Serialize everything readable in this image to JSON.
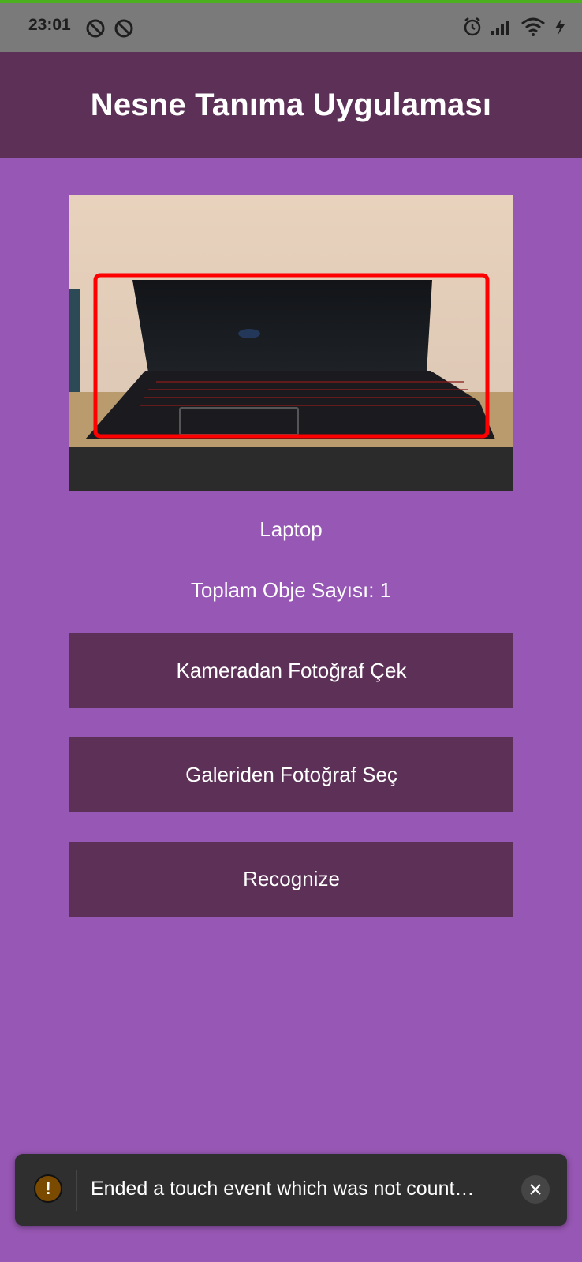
{
  "status_bar": {
    "time": "23:01"
  },
  "app_bar": {
    "title": "Nesne Tanıma Uygulaması"
  },
  "result": {
    "object_label": "Laptop",
    "total_count_text": "Toplam Obje Sayısı: 1"
  },
  "buttons": {
    "camera": "Kameradan Fotoğraf Çek",
    "gallery": "Galeriden Fotoğraf Seç",
    "recognize": "Recognize"
  },
  "toast": {
    "message": "Ended a touch event which was not count…",
    "warning_symbol": "!"
  },
  "icons": {
    "status_left": [
      "no-disturb-icon",
      "no-disturb-icon"
    ],
    "status_right": [
      "alarm-icon",
      "signal-icon",
      "wifi-icon",
      "charging-icon"
    ]
  },
  "colors": {
    "background": "#9757b4",
    "app_bar": "#5c3057",
    "button": "#5c3057",
    "status_bar": "#7a7a7a",
    "status_accent": "#4caf1f",
    "detection_box": "#ff0000",
    "toast_bg": "#2f2f2f"
  }
}
